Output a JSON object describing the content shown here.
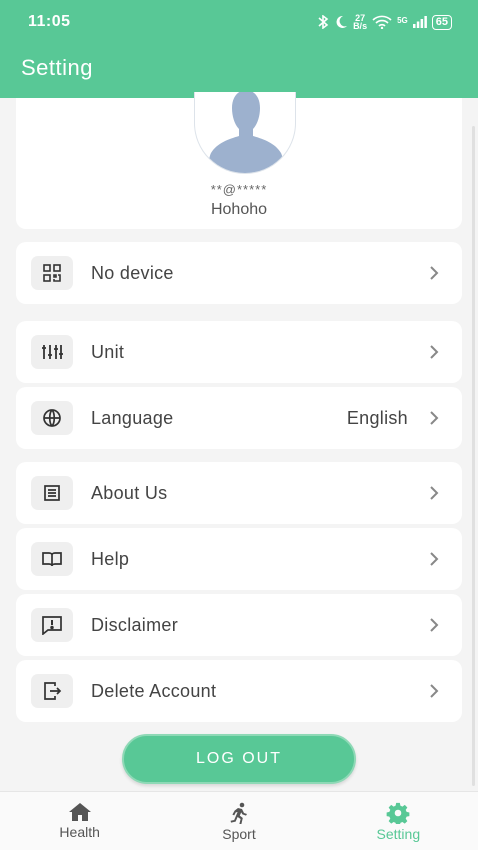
{
  "status_bar": {
    "time": "11:05",
    "speed_value": "27",
    "speed_unit": "B/s",
    "network": "5G",
    "battery": "65"
  },
  "header": {
    "title": "Setting"
  },
  "profile": {
    "email": "**@*****",
    "name": "Hohoho"
  },
  "menu": {
    "device": {
      "label": "No device",
      "icon": "qr-code-icon"
    },
    "unit": {
      "label": "Unit",
      "icon": "sliders-icon"
    },
    "language": {
      "label": "Language",
      "value": "English",
      "icon": "globe-icon"
    },
    "about": {
      "label": "About Us",
      "icon": "document-icon"
    },
    "help": {
      "label": "Help",
      "icon": "book-icon"
    },
    "disclaimer": {
      "label": "Disclaimer",
      "icon": "alert-message-icon"
    },
    "delete_account": {
      "label": "Delete Account",
      "icon": "exit-icon"
    }
  },
  "logout": {
    "label": "LOG OUT"
  },
  "bottom_nav": {
    "health": "Health",
    "sport": "Sport",
    "setting": "Setting"
  },
  "colors": {
    "accent": "#58c896",
    "background": "#f4f4f4",
    "card": "#ffffff"
  }
}
